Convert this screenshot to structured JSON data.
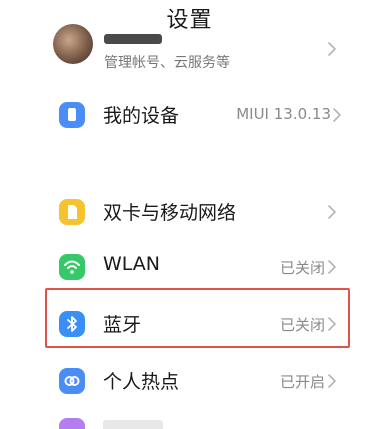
{
  "header": {
    "title": "设置"
  },
  "account": {
    "subtitle": "管理帐号、云服务等"
  },
  "items": [
    {
      "label": "我的设备",
      "value": "MIUI 13.0.13",
      "icon": "device-icon",
      "color": "#4a8df6"
    },
    {
      "label": "双卡与移动网络",
      "value": "",
      "icon": "sim-card-icon",
      "color": "#f5c230"
    },
    {
      "label": "WLAN",
      "value": "已关闭",
      "icon": "wifi-icon",
      "color": "#36c96a"
    },
    {
      "label": "蓝牙",
      "value": "已关闭",
      "icon": "bluetooth-icon",
      "color": "#3a8ff5"
    },
    {
      "label": "个人热点",
      "value": "已开启",
      "icon": "hotspot-icon",
      "color": "#4a8df6"
    }
  ],
  "colors": {
    "highlight": "#e0524a",
    "partial_icon": "#b57ef0"
  }
}
